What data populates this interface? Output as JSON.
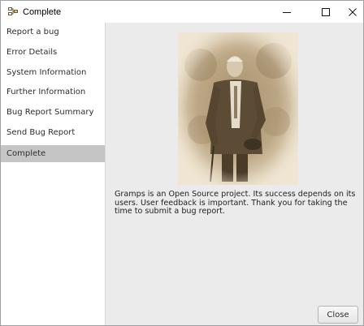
{
  "window": {
    "title": "Complete",
    "icon": "gramps-tree-icon",
    "controls": [
      "minimize-icon",
      "maximize-icon",
      "close-icon"
    ]
  },
  "sidebar": {
    "items": [
      {
        "label": "Report a bug",
        "active": false
      },
      {
        "label": "Error Details",
        "active": false
      },
      {
        "label": "System Information",
        "active": false
      },
      {
        "label": "Further Information",
        "active": false
      },
      {
        "label": "Bug Report Summary",
        "active": false
      },
      {
        "label": "Send Bug Report",
        "active": false
      },
      {
        "label": "Complete",
        "active": true
      }
    ]
  },
  "main": {
    "photo": "sepia-portrait-photo",
    "message": "Gramps is an Open Source project. Its success depends on its users. User feedback is important. Thank you for taking the time to submit a bug report."
  },
  "footer": {
    "close_label": "Close"
  },
  "colors": {
    "active_item_bg": "#c5c5c5",
    "content_bg": "#ebebeb",
    "sidebar_bg": "#ffffff"
  }
}
